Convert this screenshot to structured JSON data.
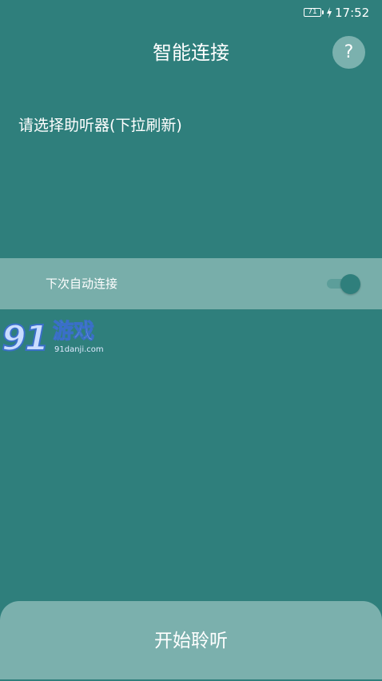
{
  "status_bar": {
    "battery_level": "71",
    "charging_icon": "charge-bolt-icon",
    "time": "17:52"
  },
  "header": {
    "title": "智能连接",
    "help_label": "?",
    "help_icon": "help-icon"
  },
  "main": {
    "prompt": "请选择助听器(下拉刷新)"
  },
  "auto_connect": {
    "label": "下次自动连接",
    "enabled": true
  },
  "watermark": {
    "logo_text": "91游戏",
    "domain": "91danji.com"
  },
  "footer": {
    "start_button_label": "开始聆听"
  },
  "colors": {
    "background": "#2f7f7c",
    "row_background": "#78aeaa",
    "bottom_panel": "#7bb0ad",
    "text": "#ffffff"
  }
}
